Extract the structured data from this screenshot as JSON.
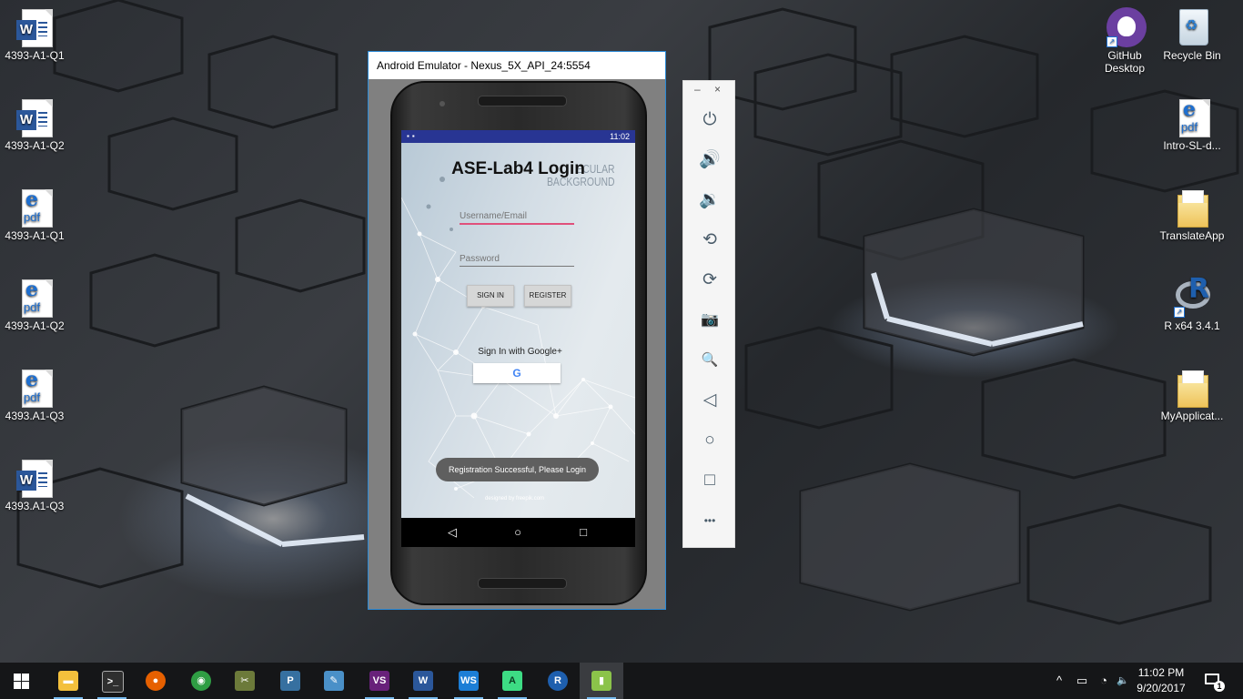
{
  "desktop": {
    "left_icons": [
      {
        "label": "4393-A1-Q1",
        "kind": "word-icon"
      },
      {
        "label": "4393-A1-Q2",
        "kind": "word-icon"
      },
      {
        "label": "4393-A1-Q1",
        "kind": "pdf-icon"
      },
      {
        "label": "4393-A1-Q2",
        "kind": "pdf-icon"
      },
      {
        "label": "4393.A1-Q3",
        "kind": "pdf-icon"
      },
      {
        "label": "4393.A1-Q3",
        "kind": "word-icon"
      }
    ],
    "right_icons": [
      {
        "label": "GitHub Desktop",
        "kind": "github-icon"
      },
      {
        "label": "Recycle Bin",
        "kind": "recycle-bin-icon"
      },
      {
        "label": "Intro-SL-d...",
        "kind": "pdf-icon"
      },
      {
        "label": "TranslateApp",
        "kind": "folder-icon"
      },
      {
        "label": "R x64 3.4.1",
        "kind": "r-icon"
      },
      {
        "label": "MyApplicat...",
        "kind": "folder-icon"
      }
    ],
    "pdf_icon_text": "pdf",
    "pdf_icon_letter": "e",
    "word_icon_letter": "W"
  },
  "emulator": {
    "window_title": "Android Emulator - Nexus_5X_API_24:5554",
    "status_bar": {
      "time": "11:02"
    },
    "app": {
      "background_text_1": "ECULAR",
      "background_text_2": "BACKGROUND",
      "background_credit": "designed by freepik.com",
      "title": "ASE-Lab4 Login",
      "username_placeholder": "Username/Email",
      "password_placeholder": "Password",
      "sign_in_label": "SIGN IN",
      "register_label": "REGISTER",
      "google_label": "Sign In with Google+",
      "google_button_glyph": "G",
      "toast": "Registration Successful, Please Login"
    },
    "nav": {
      "back": "◁",
      "home": "○",
      "recents": "□"
    },
    "sidebar": {
      "minimize": "–",
      "close": "×",
      "tools": [
        {
          "name": "power-icon",
          "glyph": "⏻"
        },
        {
          "name": "volume-up-icon",
          "glyph": "🔊"
        },
        {
          "name": "volume-down-icon",
          "glyph": "🔉"
        },
        {
          "name": "rotate-left-icon",
          "glyph": "⟲"
        },
        {
          "name": "rotate-right-icon",
          "glyph": "⟳"
        },
        {
          "name": "camera-icon",
          "glyph": "📷"
        },
        {
          "name": "zoom-icon",
          "glyph": "🔍"
        },
        {
          "name": "back-icon",
          "glyph": "◁"
        },
        {
          "name": "home-icon",
          "glyph": "○"
        },
        {
          "name": "overview-icon",
          "glyph": "□"
        },
        {
          "name": "more-icon",
          "glyph": "•••"
        }
      ]
    }
  },
  "taskbar": {
    "apps": [
      {
        "name": "file-explorer-icon",
        "glyph": "▬",
        "color": "#f3c03c"
      },
      {
        "name": "command-prompt-icon",
        "glyph": ">_",
        "color": "#2f2f2f"
      },
      {
        "name": "firefox-icon",
        "glyph": "●",
        "color": "#e66000"
      },
      {
        "name": "chrome-icon",
        "glyph": "◉",
        "color": "#2f9e44"
      },
      {
        "name": "tools-icon",
        "glyph": "✂",
        "color": "#6c7a3a"
      },
      {
        "name": "python-icon",
        "glyph": "P",
        "color": "#3670a0"
      },
      {
        "name": "notepad-icon",
        "glyph": "✎",
        "color": "#4a90c8"
      },
      {
        "name": "visual-studio-icon",
        "glyph": "VS",
        "color": "#68217a"
      },
      {
        "name": "word-icon",
        "glyph": "W",
        "color": "#2b579a"
      },
      {
        "name": "webstorm-icon",
        "glyph": "WS",
        "color": "#1c7ed6"
      },
      {
        "name": "android-studio-icon",
        "glyph": "A",
        "color": "#3ddc84"
      },
      {
        "name": "r-icon",
        "glyph": "R",
        "color": "#1e5fae"
      },
      {
        "name": "emulator-icon",
        "glyph": "▮",
        "color": "#8bc34a"
      }
    ],
    "clock_time": "11:02 PM",
    "clock_date": "9/20/2017",
    "notification_count": "1",
    "tray": {
      "chevron": "^",
      "battery": "▭",
      "wifi": "◔",
      "volume": "🔈"
    }
  }
}
